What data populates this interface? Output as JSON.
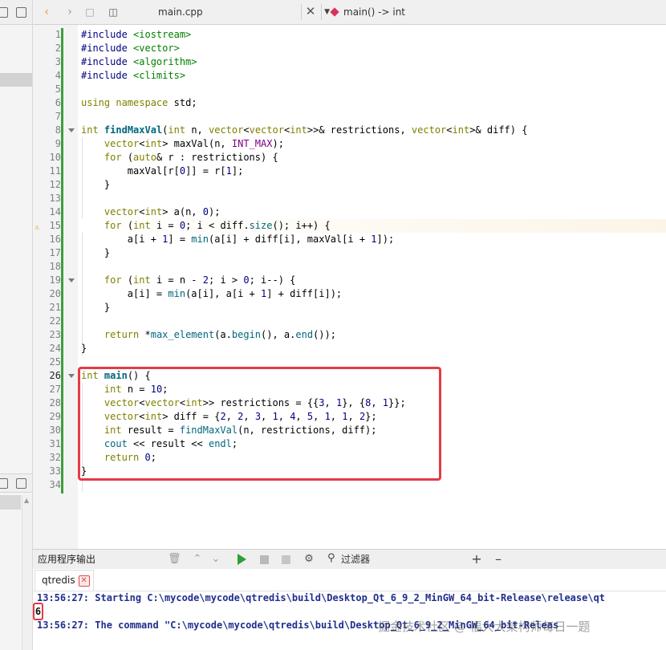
{
  "toolbar": {
    "file_name": "main.cpp",
    "function_label": "main() -> int"
  },
  "output_pane": {
    "title": "应用程序输出",
    "filter_label": "过滤器",
    "tab_label": "qtredis",
    "lines": [
      "13:56:27: Starting C:\\mycode\\mycode\\qtredis\\build\\Desktop_Qt_6_9_2_MinGW_64_bit-Release\\release\\qt",
      "6",
      "13:56:27: The command \"C:\\mycode\\mycode\\qtredis\\build\\Desktop_Qt_6_9_2_MinGW_64_bit-Releas"
    ],
    "watermark": "掘金技术社区 @ 福大大架构师每日一题"
  },
  "code": {
    "current_line": 26,
    "warning_line": 15,
    "fold_lines": [
      8,
      19,
      26
    ],
    "lines": [
      "#include <iostream>",
      "#include <vector>",
      "#include <algorithm>",
      "#include <climits>",
      "",
      "using namespace std;",
      "",
      "int findMaxVal(int n, vector<vector<int>>& restrictions, vector<int>& diff) {",
      "    vector<int> maxVal(n, INT_MAX);",
      "    for (auto& r : restrictions) {",
      "        maxVal[r[0]] = r[1];",
      "    }",
      "",
      "    vector<int> a(n, 0);",
      "    for (int i = 0; i < diff.size(); i++) {",
      "        a[i + 1] = min(a[i] + diff[i], maxVal[i + 1]);",
      "    }",
      "",
      "    for (int i = n - 2; i > 0; i--) {",
      "        a[i] = min(a[i], a[i + 1] + diff[i]);",
      "    }",
      "",
      "    return *max_element(a.begin(), a.end());",
      "}",
      "",
      "int main() {",
      "    int n = 10;",
      "    vector<vector<int>> restrictions = {{3, 1}, {8, 1}};",
      "    vector<int> diff = {2, 2, 3, 1, 4, 5, 1, 1, 2};",
      "    int result = findMaxVal(n, restrictions, diff);",
      "    cout << result << endl;",
      "    return 0;",
      "}",
      ""
    ]
  }
}
